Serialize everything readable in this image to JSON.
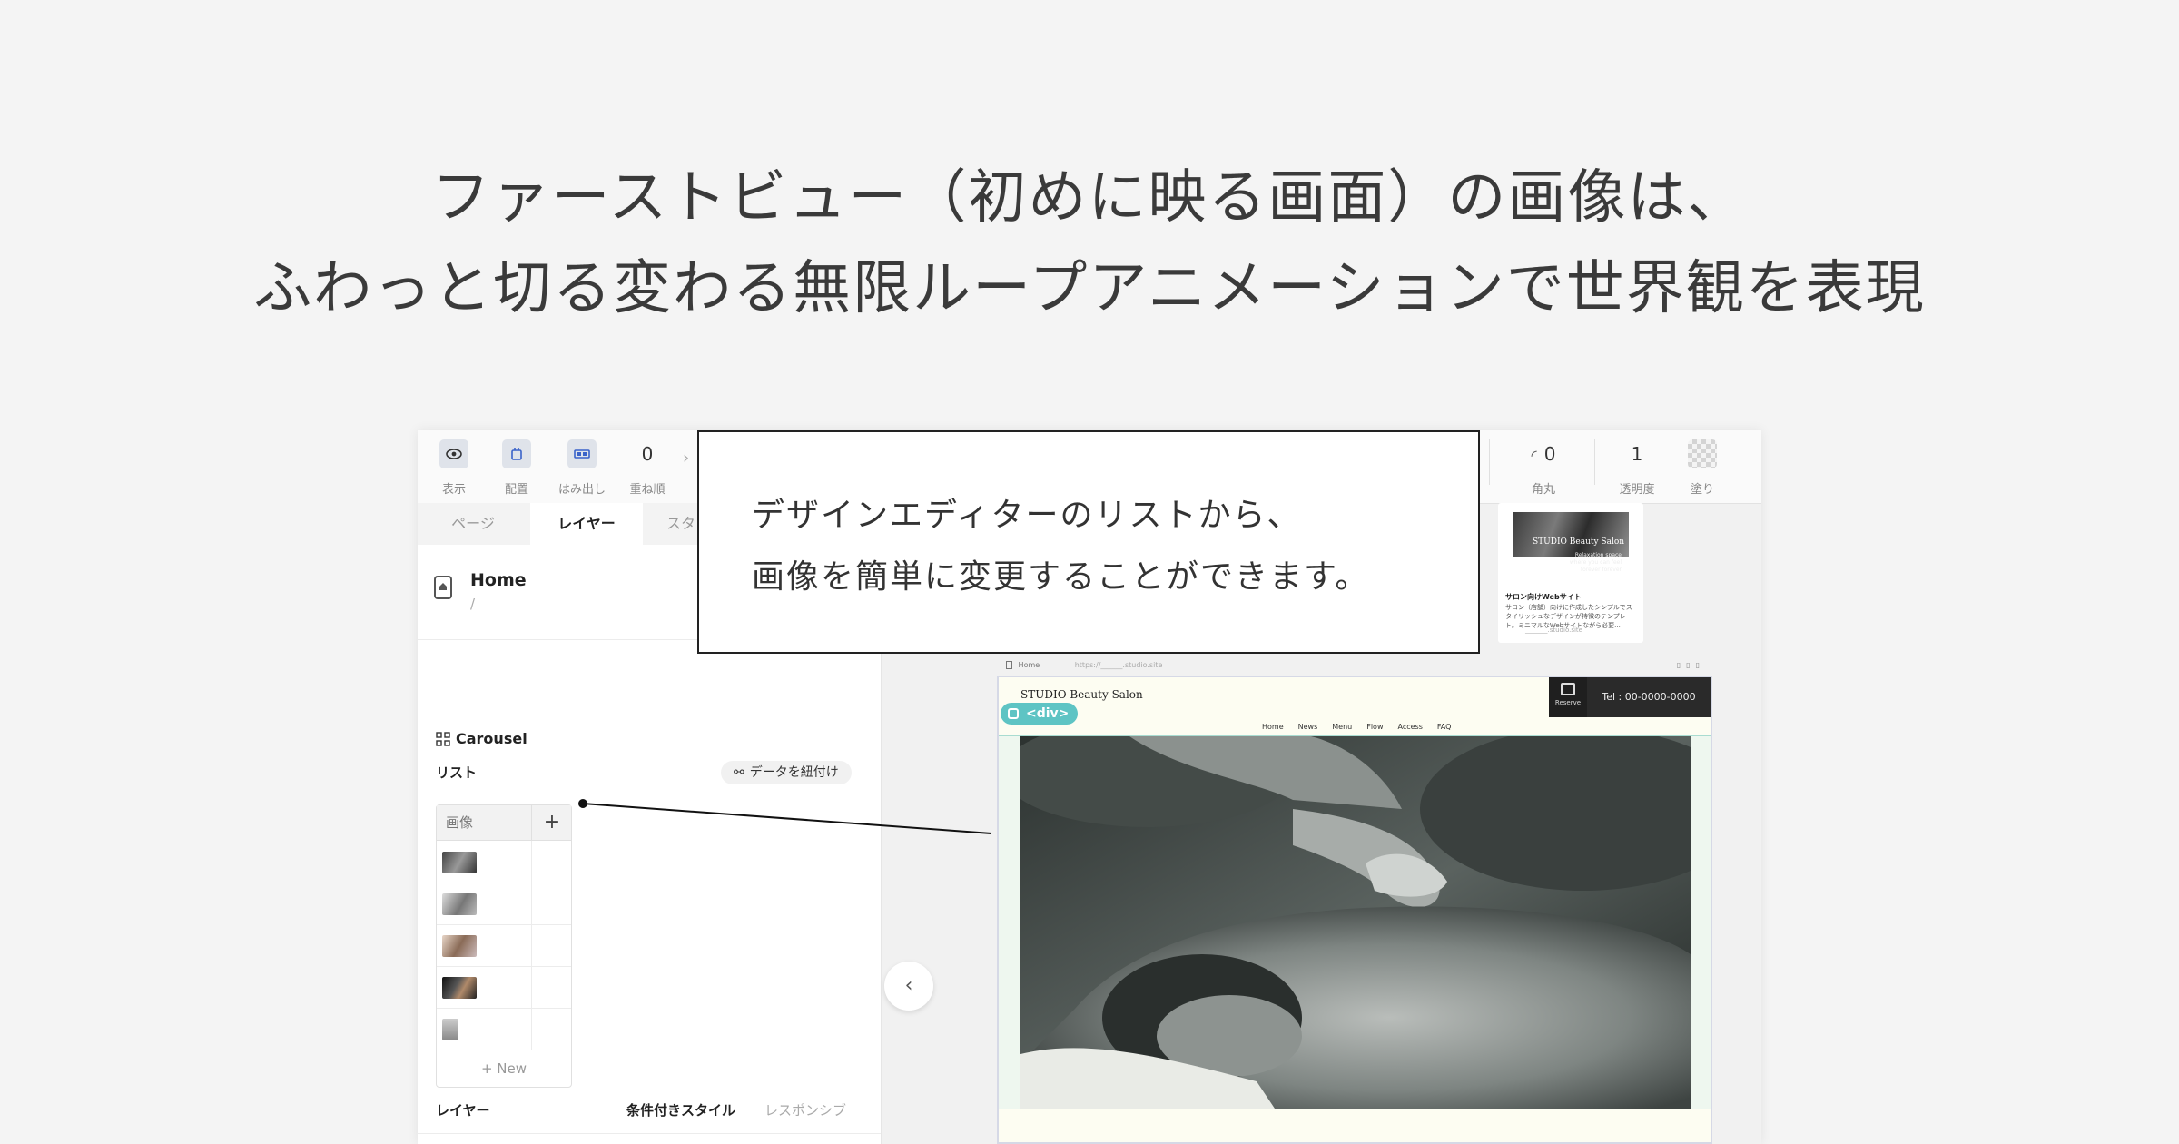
{
  "headline": {
    "line1": "ファーストビュー（初めに映る画面）の画像は、",
    "line2": "ふわっと切る変わる無限ループアニメーションで世界観を表現"
  },
  "toolbar": {
    "view_label": "表示",
    "placement_label": "配置",
    "overflow_label": "はみ出し",
    "stack_value": "0",
    "stack_label": "重ね順",
    "radius_value": "0",
    "radius_label": "角丸",
    "opacity_value": "1",
    "opacity_label": "透明度",
    "fill_label": "塗り"
  },
  "tabs": {
    "page": "ページ",
    "layer": "レイヤー",
    "style": "スタ"
  },
  "page_item": {
    "title": "Home",
    "path": "/"
  },
  "carousel": {
    "label": "Carousel"
  },
  "list": {
    "label": "リスト",
    "bind_button": "データを紐付け",
    "column": "画像",
    "add": "+",
    "new_button": "+ New",
    "rows": 5
  },
  "layer_section": {
    "label": "レイヤー",
    "conditional": "条件付きスタイル",
    "responsive": "レスポンシブ"
  },
  "callout": {
    "line1": "デザインエディターのリストから、",
    "line2": "画像を簡単に変更することができます。"
  },
  "template_card": {
    "image_title": "STUDIO Beauty Salon",
    "image_sub": "Relaxation space where you can feel forever forever",
    "title": "サロン向けWebサイト",
    "description": "サロン（店舗）向けに作成したシンプルでスタイリッシュなデザインが特徴のテンプレート。ミニマルなWebサイトながら必要...",
    "url": "_______.studio.site"
  },
  "canvas": {
    "page_name": "Home",
    "url": "https://______.studio.site",
    "div_tag": "<div>"
  },
  "site": {
    "brand": "STUDIO Beauty Salon",
    "reserve": "Reserve",
    "tel": "Tel : 00-0000-0000",
    "nav": [
      "Home",
      "News",
      "Menu",
      "Flow",
      "Access",
      "FAQ"
    ]
  },
  "colors": {
    "accent": "#5ec4c4",
    "background": "#f4f4f4"
  }
}
